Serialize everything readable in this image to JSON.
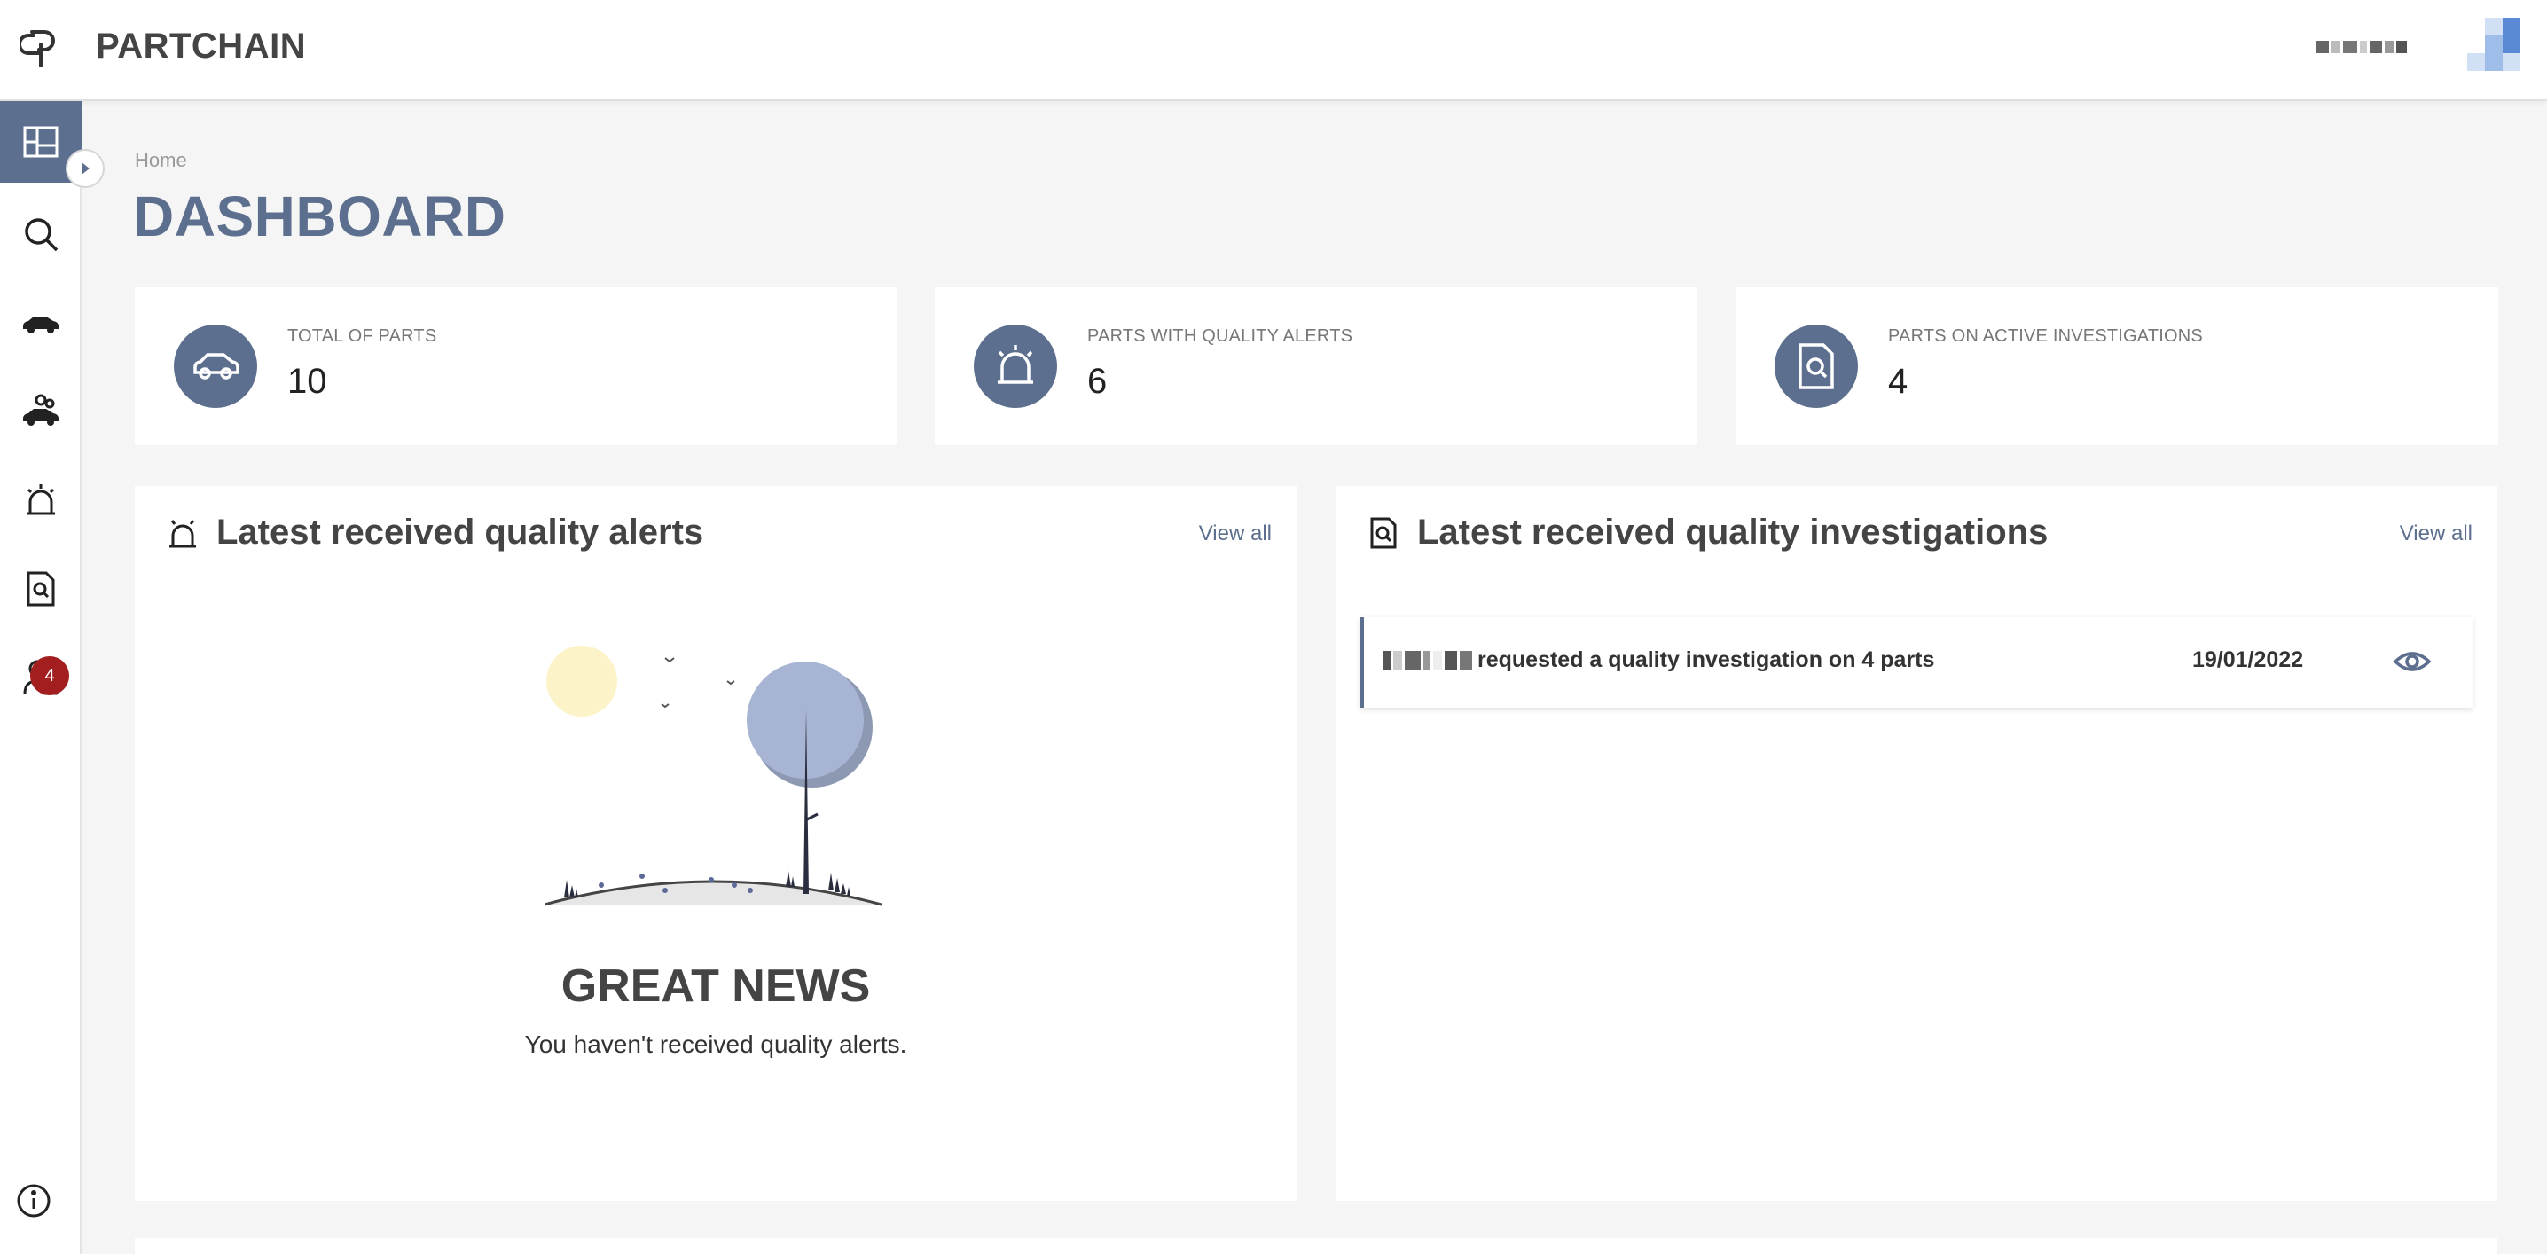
{
  "header": {
    "app_title": "PARTCHAIN",
    "logo_icon": "chain-link-logo-icon",
    "user_name_redacted": true,
    "avatar_colors": [
      "#5a8ad6",
      "#9ebde8",
      "#d2e0f5"
    ]
  },
  "sidebar": {
    "items": [
      {
        "name": "dashboard",
        "icon": "dashboard-icon",
        "active": true
      },
      {
        "name": "search",
        "icon": "search-icon"
      },
      {
        "name": "parts",
        "icon": "car-icon"
      },
      {
        "name": "other-parts",
        "icon": "car-gears-icon"
      },
      {
        "name": "alerts",
        "icon": "siren-icon"
      },
      {
        "name": "investigations",
        "icon": "document-search-icon",
        "badge": "4"
      },
      {
        "name": "admin",
        "icon": "user-lock-icon"
      }
    ],
    "info_icon": "info-icon"
  },
  "breadcrumb": "Home",
  "page_title": "DASHBOARD",
  "stats": [
    {
      "label": "TOTAL OF PARTS",
      "value": "10",
      "icon": "car-icon"
    },
    {
      "label": "PARTS WITH QUALITY ALERTS",
      "value": "6",
      "icon": "siren-icon"
    },
    {
      "label": "PARTS ON ACTIVE INVESTIGATIONS",
      "value": "4",
      "icon": "document-search-icon"
    }
  ],
  "alerts_panel": {
    "title": "Latest received quality alerts",
    "view_all": "View all",
    "empty_title": "GREAT NEWS",
    "empty_message": "You haven't received quality alerts."
  },
  "investigations_panel": {
    "title": "Latest received quality investigations",
    "view_all": "View all",
    "rows": [
      {
        "text": "requested a quality investigation on 4 parts",
        "date": "19/01/2022"
      }
    ]
  },
  "colors": {
    "accent": "#5d6f8e",
    "badge": "#a31f1f",
    "background": "#f5f5f5"
  }
}
